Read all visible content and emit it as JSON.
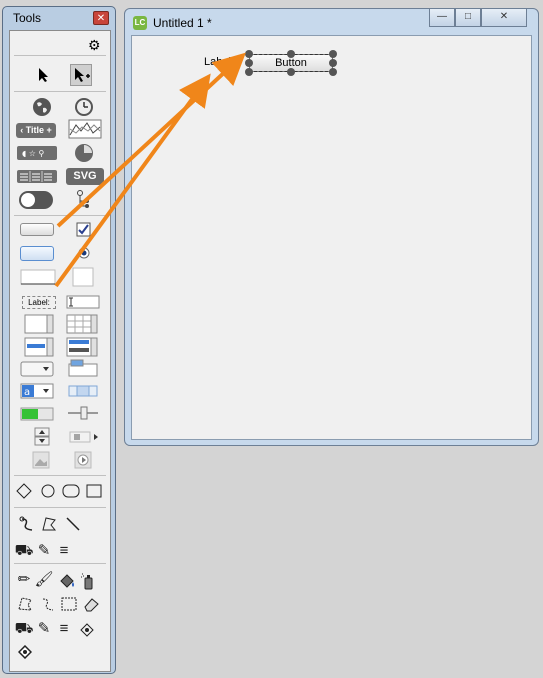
{
  "tools_palette": {
    "title": "Tools",
    "close_glyph": "✕",
    "title_tool_label": "‹ Title +",
    "svg_tool_label": "SVG",
    "label_tool_text": "Label:",
    "icons": [
      "gear-icon",
      "pointer-icon",
      "edit-pointer-icon",
      "globe-icon",
      "clock-icon",
      "title-bar-widget-icon",
      "line-graph-icon",
      "rating-icon",
      "pie-chart-icon",
      "segmented-control-icon",
      "svg-widget-icon",
      "toggle-switch-icon",
      "tree-view-icon",
      "push-button-icon",
      "checkbox-icon",
      "default-button-icon",
      "radio-button-icon",
      "field-line-icon",
      "field-box-icon",
      "label-field-icon",
      "text-entry-icon",
      "scroll-list-icon",
      "table-grid-icon",
      "list-field-icon",
      "data-grid-icon",
      "option-menu-icon",
      "tab-panel-icon",
      "combo-box-icon",
      "scrollbar-icon",
      "progress-bar-icon",
      "slider-icon",
      "little-arrows-icon",
      "player-icon",
      "image-icon",
      "video-icon",
      "diamond-icon",
      "oval-icon",
      "round-rect-icon",
      "rectangle-icon",
      "curve-icon",
      "polygon-icon",
      "line-icon",
      "bucket-icon",
      "pencil-icon",
      "lines-icon",
      "brush-icon",
      "fill-icon",
      "spray-icon",
      "lasso-icon",
      "select-icon",
      "eraser-icon",
      "dropper-icon",
      "regular-polygon-icon"
    ]
  },
  "stack_window": {
    "title": "Untitled 1 *",
    "app_badge": "LC",
    "minimize_glyph": "—",
    "maximize_glyph": "□",
    "close_glyph": "✕",
    "canvas": {
      "label_text": "Label:",
      "button_text": "Button"
    }
  },
  "colors": {
    "arrow": "#f0861a",
    "palette_frame": "#b9cde2",
    "window_frame": "#c7d9ec",
    "desktop": "#d4d4d4"
  }
}
